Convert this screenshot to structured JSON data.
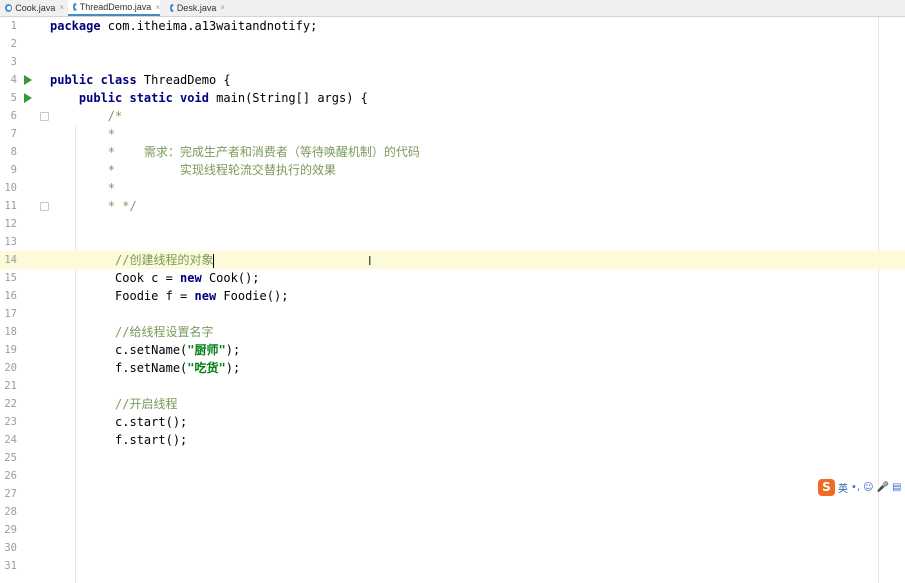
{
  "tabs": [
    {
      "label": "Cook.java",
      "active": false
    },
    {
      "label": "ThreadDemo.java",
      "active": true
    },
    {
      "label": "Desk.java",
      "active": false
    }
  ],
  "close_glyph": "×",
  "current_line": 14,
  "lines": [
    {
      "n": "1",
      "code": [
        {
          "t": "package",
          "c": "kw"
        },
        {
          "t": " com.itheima.a13waitandnotify;"
        }
      ]
    },
    {
      "n": "2",
      "code": []
    },
    {
      "n": "3",
      "code": []
    },
    {
      "n": "4",
      "run": true,
      "code": [
        {
          "t": "public class",
          "c": "kw"
        },
        {
          "t": " ThreadDemo {"
        }
      ]
    },
    {
      "n": "5",
      "run": true,
      "code": [
        {
          "t": "    "
        },
        {
          "t": "public static void",
          "c": "kw"
        },
        {
          "t": " main(String[] args) {"
        }
      ]
    },
    {
      "n": "6",
      "fold": true,
      "code": [
        {
          "t": "        /*",
          "c": "cm"
        }
      ]
    },
    {
      "n": "7",
      "code": [
        {
          "t": "        *",
          "c": "cm"
        }
      ]
    },
    {
      "n": "8",
      "code": [
        {
          "t": "        *    需求：完成生产者和消费者（等待唤醒机制）的代码",
          "c": "cm"
        }
      ]
    },
    {
      "n": "9",
      "code": [
        {
          "t": "        *         实现线程轮流交替执行的效果",
          "c": "cm"
        }
      ]
    },
    {
      "n": "10",
      "code": [
        {
          "t": "        *",
          "c": "cm"
        }
      ]
    },
    {
      "n": "11",
      "fold": true,
      "code": [
        {
          "t": "        * */",
          "c": "cm"
        }
      ]
    },
    {
      "n": "12",
      "code": []
    },
    {
      "n": "13",
      "code": []
    },
    {
      "n": "14",
      "cursor": true,
      "code": [
        {
          "t": "         //创建线程的对象",
          "c": "cm"
        }
      ]
    },
    {
      "n": "15",
      "code": [
        {
          "t": "         Cook c = "
        },
        {
          "t": "new",
          "c": "kw"
        },
        {
          "t": " Cook();"
        }
      ]
    },
    {
      "n": "16",
      "code": [
        {
          "t": "         Foodie f = "
        },
        {
          "t": "new",
          "c": "kw"
        },
        {
          "t": " Foodie();"
        }
      ]
    },
    {
      "n": "17",
      "code": []
    },
    {
      "n": "18",
      "code": [
        {
          "t": "         //给线程设置名字",
          "c": "cm"
        }
      ]
    },
    {
      "n": "19",
      "code": [
        {
          "t": "         c.setName("
        },
        {
          "t": "\"厨师\"",
          "c": "str"
        },
        {
          "t": ");"
        }
      ]
    },
    {
      "n": "20",
      "code": [
        {
          "t": "         f.setName("
        },
        {
          "t": "\"吃货\"",
          "c": "str"
        },
        {
          "t": ");"
        }
      ]
    },
    {
      "n": "21",
      "code": []
    },
    {
      "n": "22",
      "code": [
        {
          "t": "         //开启线程",
          "c": "cm"
        }
      ]
    },
    {
      "n": "23",
      "code": [
        {
          "t": "         c.start();"
        }
      ]
    },
    {
      "n": "24",
      "code": [
        {
          "t": "         f.start();"
        }
      ]
    },
    {
      "n": "25",
      "code": []
    },
    {
      "n": "26",
      "code": []
    },
    {
      "n": "27",
      "code": []
    },
    {
      "n": "28",
      "code": []
    },
    {
      "n": "29",
      "code": []
    },
    {
      "n": "30",
      "code": []
    },
    {
      "n": "31",
      "code": []
    }
  ],
  "ime": {
    "logo": "S",
    "lang": "英",
    "items": [
      "•,",
      "☺",
      "🎤",
      "▤"
    ]
  },
  "ibeam": "I"
}
